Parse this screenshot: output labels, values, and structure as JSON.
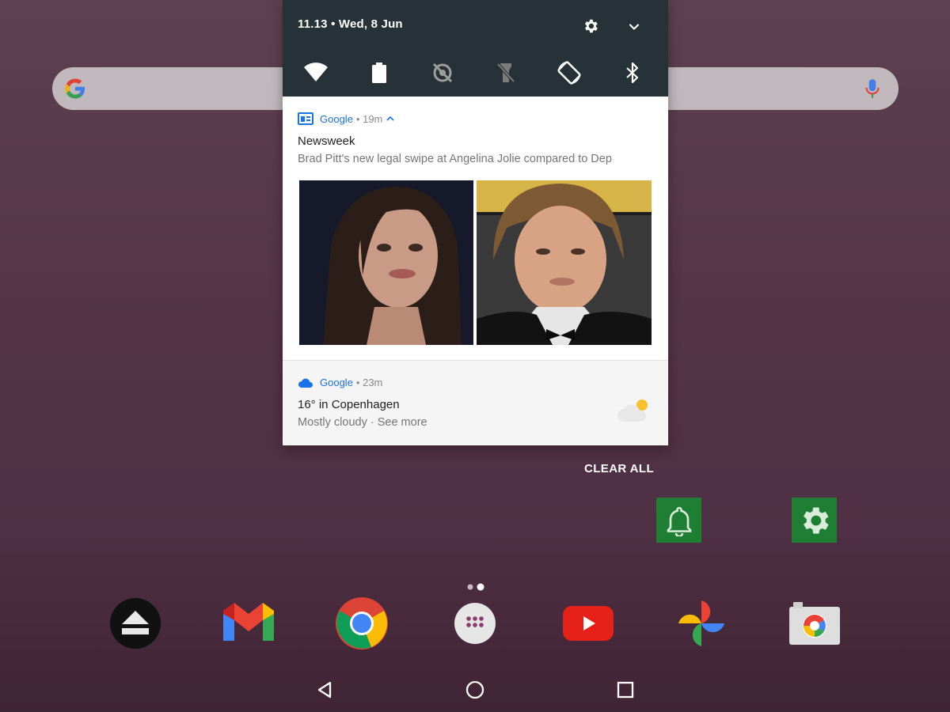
{
  "status": {
    "time_date": "11.13 • Wed, 8 Jun"
  },
  "quick_settings": {
    "tiles": [
      "wifi-icon",
      "battery-icon",
      "location-off-icon",
      "flashlight-off-icon",
      "auto-rotate-icon",
      "bluetooth-icon"
    ]
  },
  "notifications": [
    {
      "app": "Google",
      "meta": "• 19m",
      "title": "Newsweek",
      "text": "Brad Pitt's new legal swipe at Angelina Jolie compared to Dep"
    },
    {
      "app": "Google",
      "meta": "• 23m",
      "title": "16° in Copenhagen",
      "text": "Mostly cloudy · See more"
    }
  ],
  "clear_all": "CLEAR ALL",
  "home_icons": [
    "bell-icon",
    "gear-icon"
  ],
  "dock": [
    "eject-icon",
    "gmail-icon",
    "chrome-icon",
    "app-drawer-icon",
    "youtube-icon",
    "photos-icon",
    "camera-icon"
  ],
  "colors": {
    "accent": "#1a73e8",
    "shade_header": "#263238",
    "app_icon_green": "#1e7e34"
  }
}
